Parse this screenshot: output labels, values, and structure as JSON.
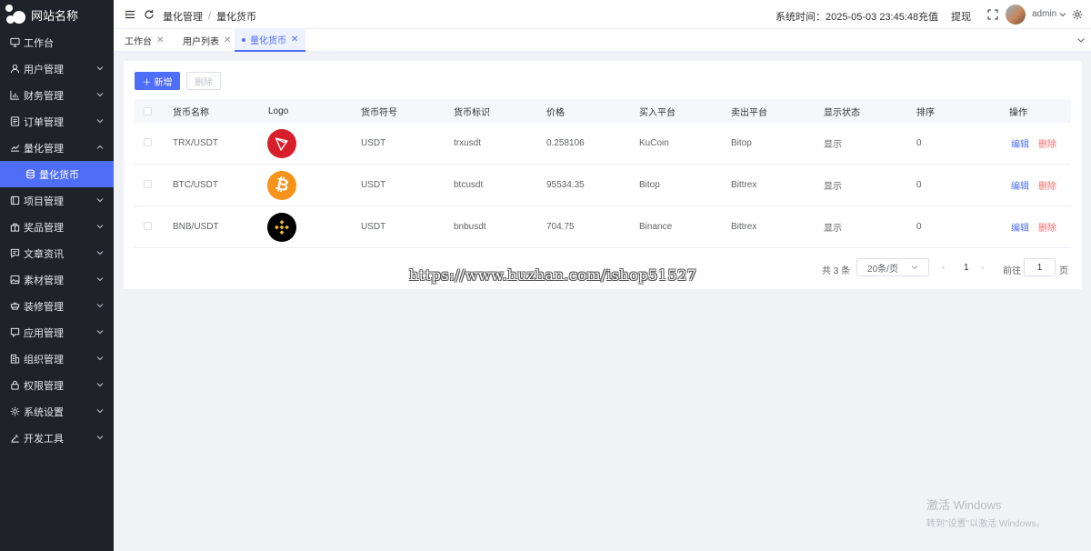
{
  "app": {
    "site_name": "网站名称"
  },
  "sidebar": {
    "items": [
      {
        "label": "工作台",
        "icon": "monitor-icon",
        "expandable": false
      },
      {
        "label": "用户管理",
        "icon": "user-icon",
        "expandable": true
      },
      {
        "label": "财务管理",
        "icon": "chart-icon",
        "expandable": true
      },
      {
        "label": "订单管理",
        "icon": "document-icon",
        "expandable": true
      },
      {
        "label": "量化管理",
        "icon": "quant-icon",
        "expandable": true,
        "expanded": true
      },
      {
        "label": "量化货币",
        "icon": "database-icon",
        "active": true,
        "sub": true
      },
      {
        "label": "项目管理",
        "icon": "folder-icon",
        "expandable": true
      },
      {
        "label": "奖品管理",
        "icon": "gift-icon",
        "expandable": true
      },
      {
        "label": "文章资讯",
        "icon": "message-icon",
        "expandable": true
      },
      {
        "label": "素材管理",
        "icon": "image-icon",
        "expandable": true
      },
      {
        "label": "装修管理",
        "icon": "brush-icon",
        "expandable": true
      },
      {
        "label": "应用管理",
        "icon": "app-icon",
        "expandable": true
      },
      {
        "label": "组织管理",
        "icon": "org-icon",
        "expandable": true
      },
      {
        "label": "权限管理",
        "icon": "lock-icon",
        "expandable": true
      },
      {
        "label": "系统设置",
        "icon": "gear-icon",
        "expandable": true
      },
      {
        "label": "开发工具",
        "icon": "tool-icon",
        "expandable": true
      }
    ]
  },
  "header": {
    "breadcrumb": [
      "量化管理",
      "量化货币"
    ],
    "system_time_label": "系统时间：2025-05-03 23:45:48",
    "recharge": "充值",
    "withdraw": "提现",
    "user": "admin"
  },
  "tabs": [
    {
      "label": "工作台",
      "active": false
    },
    {
      "label": "用户列表",
      "active": false
    },
    {
      "label": "量化货币",
      "active": true
    }
  ],
  "toolbar": {
    "add_label": "新增",
    "delete_label": "删除"
  },
  "table": {
    "columns": [
      "货币名称",
      "Logo",
      "货币符号",
      "货币标识",
      "价格",
      "买入平台",
      "卖出平台",
      "显示状态",
      "排序",
      "操作"
    ],
    "rows": [
      {
        "name": "TRX/USDT",
        "logo": "tron-logo",
        "symbol": "USDT",
        "code": "trxusdt",
        "price": "0.258106",
        "buy": "KuCoin",
        "sell": "Bitop",
        "status": "显示",
        "sort": "0"
      },
      {
        "name": "BTC/USDT",
        "logo": "bitcoin-logo",
        "symbol": "USDT",
        "code": "btcusdt",
        "price": "95534.35",
        "buy": "Bitop",
        "sell": "Bittrex",
        "status": "显示",
        "sort": "0"
      },
      {
        "name": "BNB/USDT",
        "logo": "binance-logo",
        "symbol": "USDT",
        "code": "bnbusdt",
        "price": "704.75",
        "buy": "Binance",
        "sell": "Bittrex",
        "status": "显示",
        "sort": "0"
      }
    ],
    "edit_label": "编辑",
    "delete_label": "删除"
  },
  "pagination": {
    "total_label": "共 3 条",
    "page_size": "20条/页",
    "current_page": "1",
    "goto_label": "前往",
    "goto_value": "1",
    "page_unit": "页"
  },
  "watermark": "https://www.huzhan.com/ishop51527",
  "windows_activation": {
    "title": "激活 Windows",
    "subtitle": "转到\"设置\"以激活 Windows。"
  },
  "colors": {
    "accent": "#4f6ef7",
    "sidebar_bg": "#1f2229",
    "danger": "#f56c6c",
    "tron": "#d81e2a",
    "bitcoin": "#f7931a",
    "binance": "#f3ba2f"
  }
}
